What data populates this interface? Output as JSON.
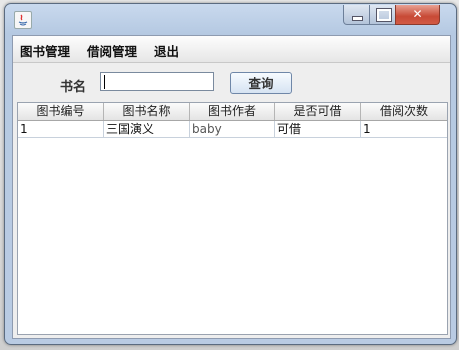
{
  "window": {
    "title": ""
  },
  "menu": {
    "items": [
      "图书管理",
      "借阅管理",
      "退出"
    ]
  },
  "search": {
    "label": "书名",
    "value": "",
    "button_label": "查询"
  },
  "table": {
    "columns": [
      "图书编号",
      "图书名称",
      "图书作者",
      "是否可借",
      "借阅次数"
    ],
    "rows": [
      [
        "1",
        "三国演义",
        "baby",
        "可借",
        "1"
      ]
    ]
  },
  "colors": {
    "close_button": "#c74a36",
    "window_frame": "#b9cbe3"
  }
}
